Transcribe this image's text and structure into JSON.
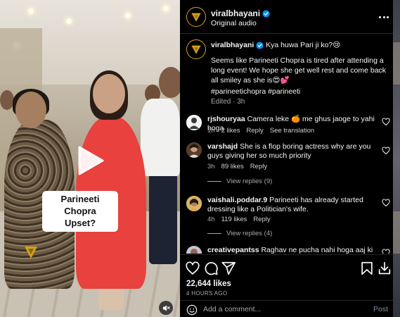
{
  "header": {
    "username": "viralbhayani",
    "subtitle": "Original audio",
    "more_icon": "more-horizontal-icon"
  },
  "video": {
    "overlay_caption_line1": "Parineeti Chopra",
    "overlay_caption_line2": "Upset?",
    "play_icon": "play-icon",
    "sound_icon": "speaker-muted-icon"
  },
  "caption": {
    "username": "viralbhayani",
    "headline": "Kya huwa Pari ji ko?😢",
    "body": "Seems like Parineeti Chopra is tired after attending a long event! We hope she get well rest and come back all smiley as she is😍💕",
    "hashtags": "#parineetichopra #parineeti",
    "meta": "Edited · 3h"
  },
  "comments": [
    {
      "username": "rjshouryaa",
      "text": "Camera leke 🍊 me ghus jaoge to yahi hoga",
      "time": "1h",
      "likes": "2 likes",
      "reply": "Reply",
      "extra": "See translation",
      "view_replies": ""
    },
    {
      "username": "varshajd",
      "text": "She is a flop boring actress why are you guys giving her so much priority",
      "time": "3h",
      "likes": "89 likes",
      "reply": "Reply",
      "extra": "",
      "view_replies": "View replies (9)"
    },
    {
      "username": "vaishali.poddar.9",
      "text": "Parineeti has already started dressing like a Politician's wife.",
      "time": "4h",
      "likes": "119 likes",
      "reply": "Reply",
      "extra": "",
      "view_replies": "View replies (4)"
    },
    {
      "username": "creativepantss",
      "text": "Raghav ne pucha nahi hoga aaj ki khana khaya",
      "time": "",
      "likes": "",
      "reply": "",
      "extra": "",
      "view_replies": ""
    }
  ],
  "actions": {
    "like_icon": "heart-icon",
    "comment_icon": "comment-icon",
    "share_icon": "share-icon",
    "save_icon": "bookmark-icon",
    "download_icon": "download-icon",
    "likes_count": "22,644 likes",
    "time_ago": "4 HOURS AGO"
  },
  "composer": {
    "placeholder": "Add a comment...",
    "post_label": "Post",
    "emoji_icon": "emoji-icon"
  },
  "colors": {
    "background": "#000000",
    "muted_text": "#a8a8a8",
    "verified_blue": "#0095f6",
    "post_button": "#7f8fa6",
    "logo_gold": "#d4a017"
  }
}
